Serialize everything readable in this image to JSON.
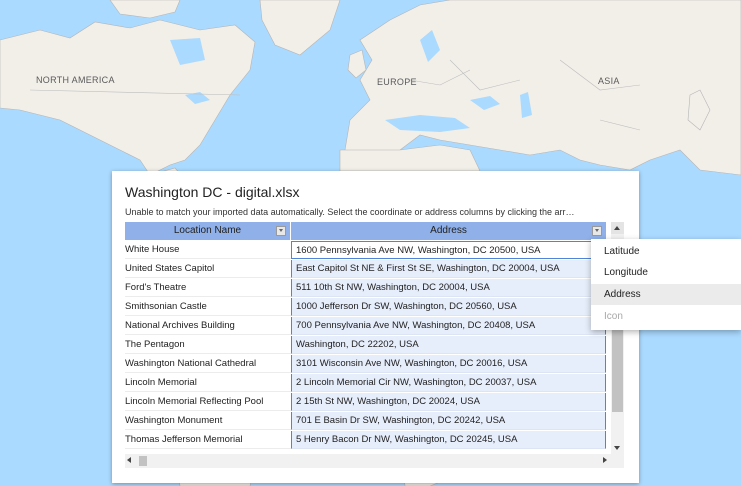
{
  "map": {
    "labels": {
      "north_america": "NORTH AMERICA",
      "europe": "EUROPE",
      "asia": "ASIA"
    },
    "colors": {
      "water": "#aadaff",
      "land": "#f2efe9",
      "border": "#a8a8a8"
    }
  },
  "dialog": {
    "title": "Washington DC - digital.xlsx",
    "message": "Unable to match your imported data automatically. Select the coordinate or address columns by clicking the arr…",
    "columns": {
      "name": "Location Name",
      "address": "Address"
    },
    "rows": [
      {
        "name": "White House",
        "address": "1600 Pennsylvania Ave NW, Washington, DC 20500, USA"
      },
      {
        "name": "United States Capitol",
        "address": "East Capitol St NE & First St SE, Washington, DC 20004, USA"
      },
      {
        "name": "Ford's Theatre",
        "address": "511 10th St NW, Washington, DC 20004, USA"
      },
      {
        "name": "Smithsonian Castle",
        "address": "1000 Jefferson Dr SW, Washington, DC 20560, USA"
      },
      {
        "name": "National Archives Building",
        "address": "700 Pennsylvania Ave NW, Washington, DC 20408, USA"
      },
      {
        "name": "The Pentagon",
        "address": "Washington, DC 22202, USA"
      },
      {
        "name": "Washington National Cathedral",
        "address": "3101 Wisconsin Ave NW, Washington, DC 20016, USA"
      },
      {
        "name": "Lincoln Memorial",
        "address": "2 Lincoln Memorial Cir NW, Washington, DC 20037, USA"
      },
      {
        "name": "Lincoln Memorial Reflecting Pool",
        "address": "2 15th St NW, Washington, DC 20024, USA"
      },
      {
        "name": "Washington Monument",
        "address": "701 E Basin Dr SW, Washington, DC 20242, USA"
      },
      {
        "name": "Thomas Jefferson Memorial",
        "address": "5 Henry Bacon Dr NW, Washington, DC 20245, USA"
      }
    ]
  },
  "column_menu": {
    "items": [
      {
        "label": "Latitude",
        "state": "normal"
      },
      {
        "label": "Longitude",
        "state": "normal"
      },
      {
        "label": "Address",
        "state": "highlighted"
      },
      {
        "label": "Icon",
        "state": "disabled"
      }
    ]
  }
}
